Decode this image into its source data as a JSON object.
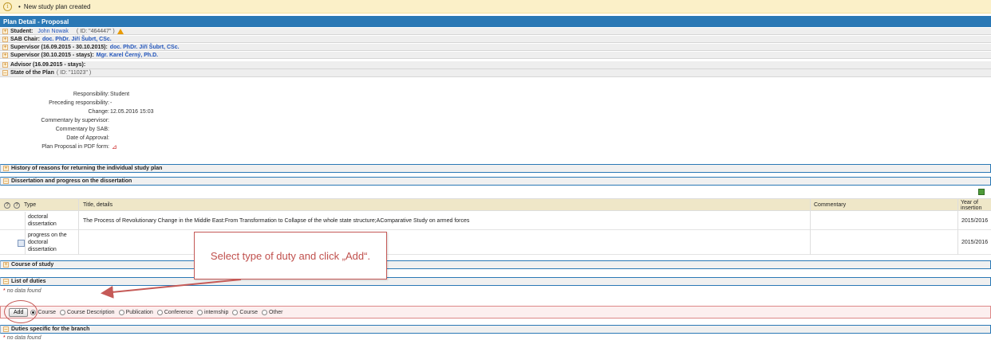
{
  "notice": {
    "text": "New study plan created"
  },
  "panel": {
    "title": "Plan Detail - Proposal"
  },
  "student": {
    "label": "Student:",
    "name": "John Nowak",
    "id": "( ID: \"464447\" )"
  },
  "sab_chair": {
    "label": "SAB Chair:",
    "value": "doc. PhDr. Jiří Šubrt, CSc."
  },
  "supervisor1": {
    "label": "Supervisor (16.09.2015 - 30.10.2015):",
    "value": "doc. PhDr. Jiří Šubrt, CSc."
  },
  "supervisor2": {
    "label": "Supervisor (30.10.2015 - stays):",
    "value": "Mgr. Karel Černý, Ph.D."
  },
  "advisor": {
    "label": "Advisor (16.09.2015 - stays):"
  },
  "state": {
    "label": "State of the Plan",
    "id": "( ID: \"11023\" )",
    "rows": [
      {
        "label": "Responsibility:",
        "value": "Student"
      },
      {
        "label": "Preceding responsibility:",
        "value": "-"
      },
      {
        "label": "Change:",
        "value": "12.05.2016 15:03"
      },
      {
        "label": "Commentary by supervisor:",
        "value": ""
      },
      {
        "label": "Commentary by SAB:",
        "value": ""
      },
      {
        "label": "Date of Approval:",
        "value": ""
      },
      {
        "label": "Plan Proposal in PDF form:",
        "value": ""
      }
    ]
  },
  "sections": {
    "history": "History of reasons for returning the individual study plan",
    "dissertation": "Dissertation and progress on the dissertation",
    "course": "Course of study",
    "duties": "List of duties",
    "branch": "Duties specific for the branch"
  },
  "grid": {
    "headers": {
      "type": "Type",
      "title": "Title, details",
      "commentary": "Commentary",
      "year": "Year of insertion"
    },
    "rows": [
      {
        "type": "doctoral dissertation",
        "title": "The Process of Revolutionary Change in the Middle East:From Transformation to Collapse of the whole state structure;AComparative Study on armed forces",
        "commentary": "",
        "year": "2015/2016"
      },
      {
        "type": "progress on the doctoral dissertation",
        "title": "",
        "commentary": "",
        "year": "2015/2016"
      }
    ]
  },
  "nodata": {
    "text": "no data found"
  },
  "tooltip": {
    "text": "Select type of duty and click „Add“."
  },
  "addbar": {
    "button": "Add",
    "options": [
      "Course",
      "Course Description",
      "Publication",
      "Conference",
      "internship",
      "Course",
      "Other"
    ],
    "selected_index": 0
  },
  "colors": {
    "title_bar": "#2a78b5",
    "notice_bg": "#fbf0c8",
    "callout": "#c0504d",
    "link": "#2255bb"
  },
  "icons": {
    "notice": "info-icon",
    "warning": "warning-icon",
    "pdf": "pdf-icon",
    "excel": "excel-icon",
    "document": "document-icon"
  }
}
